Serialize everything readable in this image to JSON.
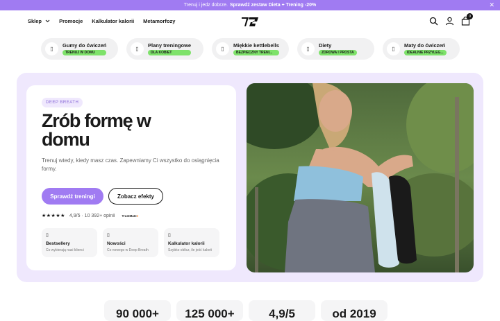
{
  "promo": {
    "text": "Trenuj i jedz dobrze.",
    "link": "Sprawdź zestaw Dieta + Trening -20%"
  },
  "nav": {
    "items": [
      "Sklep",
      "Promocje",
      "Kalkulator kalorii",
      "Metamorfozy"
    ],
    "cart_count": "0"
  },
  "categories": [
    {
      "title": "Gumy do ćwiczeń",
      "badge": "TRENUJ W DOMU"
    },
    {
      "title": "Plany treningowe",
      "badge": "DLA KOBIET"
    },
    {
      "title": "Miękkie kettlebells",
      "badge": "BEZPIECZNY TRENI..."
    },
    {
      "title": "Diety",
      "badge": "ZDROWA I PROSTA"
    },
    {
      "title": "Maty do ćwiczeń",
      "badge": "IDEALNIE PRZYLEG..."
    }
  ],
  "hero": {
    "tag": "DEEP BREATH",
    "headline": "Zrób formę w domu",
    "subtitle": "Trenuj wtedy, kiedy masz czas. Zapewniamy Ci wszystko do osiągnięcia formy.",
    "primary_button": "Sprawdź treningi",
    "secondary_button": "Zobacz efekty",
    "stars": "★★★★★",
    "rating_text": "4,9/5 · 10 392+ opinii",
    "trustmate_label": "TrustMate",
    "features": [
      {
        "title": "Bestsellery",
        "subtitle": "Co wybierają nasi klienci"
      },
      {
        "title": "Nowości",
        "subtitle": "Co nowego w Deep Breath"
      },
      {
        "title": "Kalkulator kalorii",
        "subtitle": "Szybko oblicz, ile jeść kalorii"
      }
    ]
  },
  "stats": [
    "90 000+",
    "125 000+",
    "4,9/5",
    "od 2019"
  ],
  "colors": {
    "accent": "#a07bf2",
    "badge_green": "#7ee26a",
    "hero_bg": "#efe8fd"
  }
}
